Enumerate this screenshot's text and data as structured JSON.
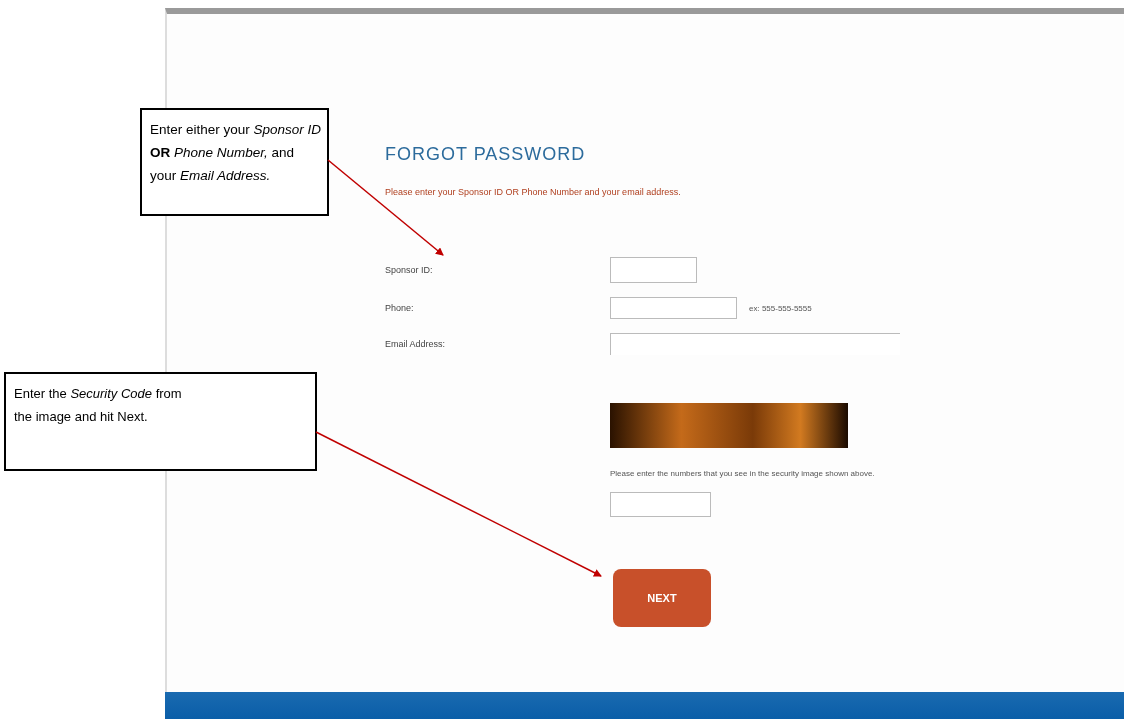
{
  "page": {
    "title": "FORGOT PASSWORD",
    "instruction": "Please enter your Sponsor ID OR Phone Number and your email address.",
    "fields": [
      {
        "label": "Sponsor ID:"
      },
      {
        "label": "Phone:",
        "hint": "ex: 555-555-5555"
      },
      {
        "label": "Email Address:"
      }
    ],
    "captcha_instruction": "Please enter the numbers that you see in the security image shown above.",
    "next_button": "NEXT"
  },
  "callouts": [
    {
      "text": "Enter either your *Sponsor ID* **OR** *Phone Number,* and your *Email Address.*"
    },
    {
      "text": "Enter the *Security Code* from the image and hit Next."
    }
  ]
}
